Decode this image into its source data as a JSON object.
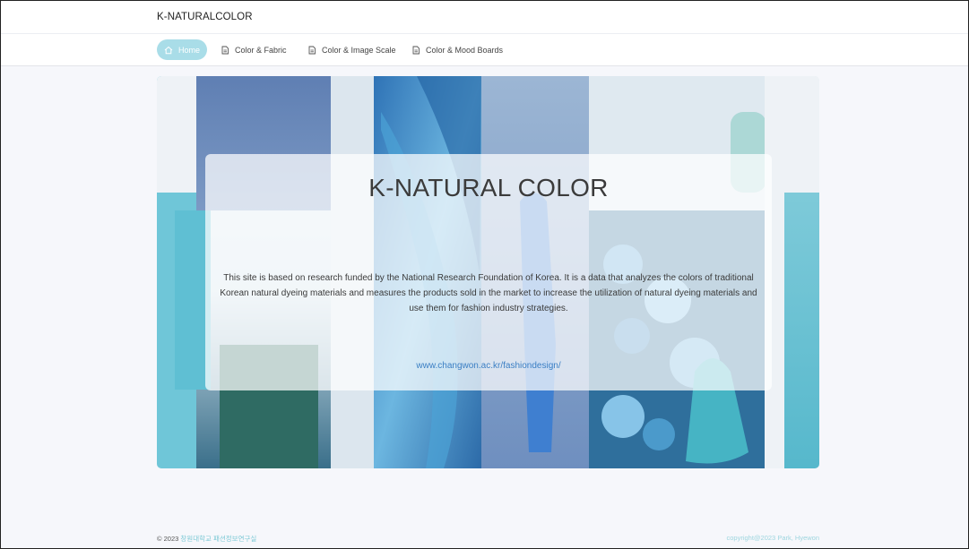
{
  "brand": "K-NATURALCOLOR",
  "nav": {
    "items": [
      {
        "label": "Home",
        "icon": "home-icon",
        "active": true
      },
      {
        "label": "Color & Fabric",
        "icon": "document-icon",
        "active": false
      },
      {
        "label": "Color & Image Scale",
        "icon": "document-icon",
        "active": false
      },
      {
        "label": "Color & Mood Boards",
        "icon": "document-icon",
        "active": false
      }
    ]
  },
  "hero": {
    "title": "K-NATURAL COLOR",
    "description": "This site is based on research funded by the National Research Foundation of Korea. It is a data that analyzes the colors of traditional Korean natural dyeing materials and measures the products sold in the market to increase the utilization of natural dyeing materials and use them for fashion industry strategies.",
    "link": "www.changwon.ac.kr/fashiondesign/"
  },
  "footer": {
    "copyright_prefix": "© 2023",
    "lab_name": "창원대학교 패션정보연구실",
    "right_text": "copyright@2023 Park, Hyewon"
  },
  "colors": {
    "accent": "#a9dde8",
    "link": "#3b7fc4",
    "background": "#f6f7fb"
  }
}
